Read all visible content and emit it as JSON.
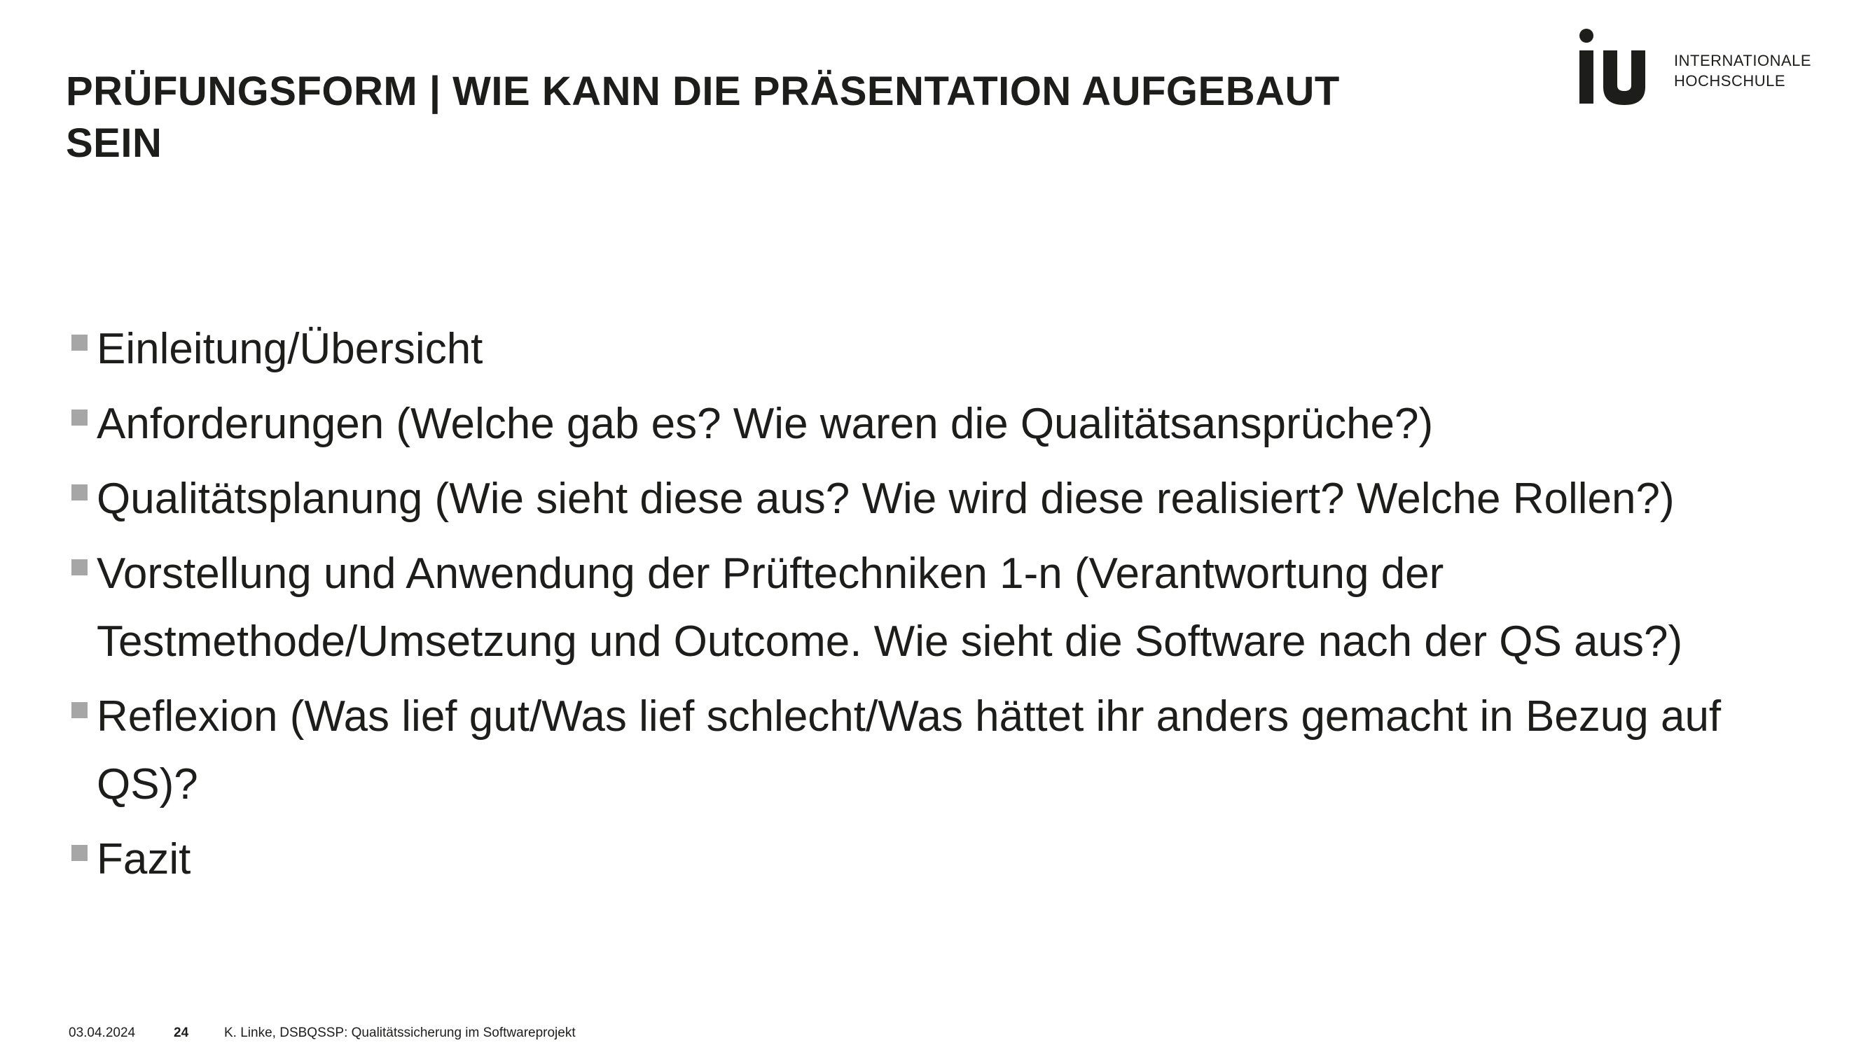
{
  "slide": {
    "title": "PRÜFUNGSFORM | WIE KANN DIE PRÄSENTATION AUFGEBAUT SEIN"
  },
  "logo": {
    "mark": "iu",
    "line1": "INTERNATIONALE",
    "line2": "HOCHSCHULE"
  },
  "bullets": [
    {
      "text": "Einleitung/Übersicht"
    },
    {
      "text": "Anforderungen (Welche gab es? Wie waren die Qualitätsansprüche?)"
    },
    {
      "text": "Qualitätsplanung (Wie sieht diese aus? Wie wird diese realisiert? Welche Rollen?)"
    },
    {
      "text": "Vorstellung und Anwendung der Prüftechniken 1-n (Verantwortung der Testmethode/Umsetzung und Outcome. Wie sieht die Software nach der QS aus?)"
    },
    {
      "text": "Reflexion (Was lief gut/Was lief schlecht/Was hättet ihr anders gemacht in Bezug auf QS)?"
    },
    {
      "text": "Fazit"
    }
  ],
  "footer": {
    "date": "03.04.2024",
    "page": "24",
    "author": "K. Linke, ",
    "course_code": "DSBQSSP",
    "course_title": ": Qualitätssicherung im Softwareprojekt"
  },
  "colors": {
    "text": "#1d1d1b",
    "bullet_marker": "#a6a6a6",
    "background": "#ffffff"
  }
}
